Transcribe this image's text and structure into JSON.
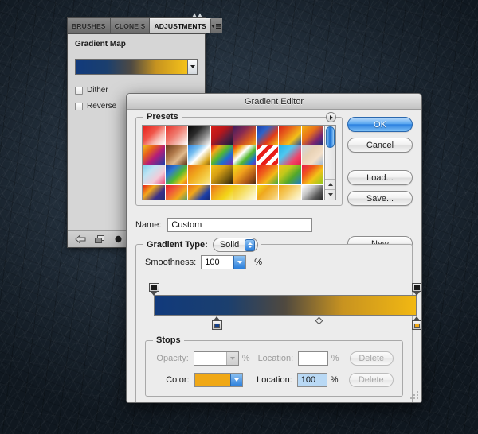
{
  "adjustments_panel": {
    "tabs": [
      {
        "label": "BRUSHES",
        "active": false
      },
      {
        "label": "CLONE S",
        "active": false
      },
      {
        "label": "ADJUSTMENTS",
        "active": true
      }
    ],
    "menu_icon": "panel-menu-icon",
    "collapse_icon": "collapse-chevrons-icon",
    "title": "Gradient Map",
    "gradient_preview": {
      "icon": "gradient-dropdown-arrow-icon",
      "stops": [
        {
          "pos": 0,
          "color": "#113a7c"
        },
        {
          "pos": 28,
          "color": "#1b3f6e"
        },
        {
          "pos": 50,
          "color": "#4f4a43"
        },
        {
          "pos": 72,
          "color": "#c69320"
        },
        {
          "pos": 100,
          "color": "#f5c21a"
        }
      ]
    },
    "checkboxes": [
      {
        "label": "Dither",
        "checked": false
      },
      {
        "label": "Reverse",
        "checked": false
      }
    ],
    "footer_icons": [
      "back-arrow-icon",
      "clip-layer-icon",
      "toggle-visibility-icon",
      "reset-icon",
      "delete-icon"
    ]
  },
  "gradient_editor": {
    "title": "Gradient Editor",
    "presets": {
      "legend": "Presets",
      "menu_icon": "presets-menu-icon",
      "scrollbar": {
        "up_icon": "scroll-up-arrow-icon",
        "down_icon": "scroll-down-arrow-icon"
      },
      "swatches": [
        "linear-gradient(135deg,#e81d18 0%,#f0564a 42%,#f7bbb2 70%,#ffffff 100%)",
        "linear-gradient(135deg,#e83028 0%,#ef7a6e 45%,#f4b9ae 72%,#fdfdfd 100%)",
        "linear-gradient(135deg,#050505 0%,#2a2a2a 35%,#8d8d8d 68%,#ffffff 100%)",
        "linear-gradient(135deg,#d91f17 0%,#b8171b 40%,#5a1f3e 70%,#1a1a3c 100%)",
        "linear-gradient(135deg,#3d1d5e 0%,#8a2b51 38%,#d65a20 70%,#f2a81a 100%)",
        "linear-gradient(135deg,#1a3ea8 0%,#2f63c8 32%,#e03a1a 66%,#f3c318 100%)",
        "linear-gradient(135deg,#d91f17 0%,#e8671b 35%,#f2c018 68%,#1d4fa8 100%)",
        "linear-gradient(135deg,#f2b311 0%,#e8701a 40%,#7b2470 72%,#1b2f7a 100%)",
        "linear-gradient(135deg,#f0c01a 0%,#e8601c 30%,#b31d7a 58%,#1f3fa8 100%)",
        "linear-gradient(135deg,#6b3a1c 0%,#b0794a 38%,#e0b98c 64%,#5b3318 100%)",
        "linear-gradient(135deg,#2f86e0 0%,#7cc1f0 30%,#ffffff 52%,#d9a820 82%,#8a6412 100%)",
        "linear-gradient(135deg,#e81d18 0%,#f2a81a 22%,#53b830 46%,#1d6fd0 70%,#7b2ab0 100%)",
        "linear-gradient(135deg,#e81d18 0%,#f2a81a 20%,#ffffff 40%,#53b830 62%,#1d6fd0 84%,#7b2ab0 100%)",
        "repeating-linear-gradient(135deg,#e81d18 0 5px,#ffffff 5px 10px)",
        "linear-gradient(135deg,#22b3e8 0%,#4fc7ef 35%,#f0456a 72%,#e81d4a 100%)",
        "linear-gradient(135deg,#cdd5de 0%,#e8d2b5 38%,#f3dfc8 68%,#9fb8d0 100%)",
        "linear-gradient(135deg,#7fd0ef 0%,#c0e4f3 32%,#f3cbd8 66%,#e8477a 100%)",
        "linear-gradient(135deg,#1d3fa8 0%,#2f7ad0 28%,#53b830 56%,#f2c318 80%,#e8601c 100%)",
        "linear-gradient(135deg,#e8701a 0%,#f0a91c 40%,#f4cf4a 72%,#f7e69a 100%)",
        "linear-gradient(135deg,#f2c318 0%,#d8a014 35%,#7c5f10 70%,#2a2008 100%)",
        "linear-gradient(135deg,#f2e018 0%,#f0a01c 38%,#b05a18 70%,#4a2a10 100%)",
        "linear-gradient(135deg,#e81d18 0%,#f0601c 35%,#f2b818 65%,#3aa840 100%)",
        "linear-gradient(135deg,#f2c318 0%,#c0c81a 32%,#52a82a 62%,#1d7ad0 100%)",
        "linear-gradient(135deg,#e81d4a 0%,#f0561c 30%,#f2c318 60%,#8ac81a 100%)",
        "linear-gradient(135deg,#e81d18 0%,#f2a81a 30%,#3a2f8a 62%,#1d2f6a 100%)",
        "linear-gradient(135deg,#e81d2a 0%,#f05a3a 30%,#f2a81a 60%,#1d9a88 100%)",
        "linear-gradient(135deg,#e8701a 0%,#f2a81a 30%,#1d3fa8 64%,#101a5a 100%)",
        "linear-gradient(135deg,#e8701a 0%,#f0a81c 32%,#f2d418 62%,#f7ee9a 100%)",
        "linear-gradient(135deg,#f2c318 0%,#f5dc5a 35%,#faf0b0 68%,#ffffff 100%)",
        "linear-gradient(135deg,#f2e018 0%,#f0a81c 34%,#f4c760 68%,#fcf2c8 100%)",
        "linear-gradient(135deg,#f2a81a 0%,#f5c85a 34%,#faeab0 68%,#ffffff 100%)",
        "linear-gradient(135deg,#ffffff 0%,#c8c8c8 30%,#5a5a5a 62%,#101010 100%)",
        "linear-gradient(135deg,#0a0a0a 0%,#4a4a4a 30%,#b0b0b0 62%,#ffffff 100%)",
        "linear-gradient(135deg,#1d4fd0 0%,#5a92e8 32%,#c5dcf5 66%,#ffffff 100%)"
      ]
    },
    "buttons": {
      "ok": "OK",
      "cancel": "Cancel",
      "load": "Load...",
      "save": "Save...",
      "new": "New"
    },
    "name": {
      "label": "Name:",
      "value": "Custom",
      "placeholder": ""
    },
    "gradient_type": {
      "label": "Gradient Type:",
      "value": "Solid",
      "stepper_icon": "stepper-up-down-icon"
    },
    "smoothness": {
      "label": "Smoothness:",
      "value": "100",
      "unit": "%",
      "dropdown_icon": "chevron-down-icon"
    },
    "gradient_strip": {
      "stops": [
        {
          "pos": 0,
          "color": "#113a7c"
        },
        {
          "pos": 28,
          "color": "#1b3f6e"
        },
        {
          "pos": 50,
          "color": "#50493f"
        },
        {
          "pos": 72,
          "color": "#c89320"
        },
        {
          "pos": 100,
          "color": "#f2b812"
        }
      ],
      "opacity_stops": [
        {
          "pos": 0,
          "color": "#1a1a1a"
        },
        {
          "pos": 100,
          "color": "#1a1a1a"
        }
      ],
      "color_stops": [
        {
          "pos": 24,
          "color": "#15408a"
        },
        {
          "pos": 100,
          "color": "#f0a816"
        }
      ],
      "midpoints": [
        {
          "pos": 63
        }
      ]
    },
    "stops": {
      "legend": "Stops",
      "opacity": {
        "label": "Opacity:",
        "value": "",
        "unit": "%",
        "disabled": true,
        "dropdown_icon": "chevron-down-icon"
      },
      "opacity_location": {
        "label": "Location:",
        "value": "",
        "unit": "%",
        "disabled": true
      },
      "opacity_delete": {
        "label": "Delete",
        "disabled": true
      },
      "color": {
        "label": "Color:",
        "swatch": "#f0a816",
        "dropdown_icon": "chevron-down-icon"
      },
      "color_location": {
        "label": "Location:",
        "value": "100",
        "unit": "%",
        "selected": true
      },
      "color_delete": {
        "label": "Delete",
        "disabled": true
      }
    },
    "resize_grip_icon": "resize-grip-icon"
  }
}
